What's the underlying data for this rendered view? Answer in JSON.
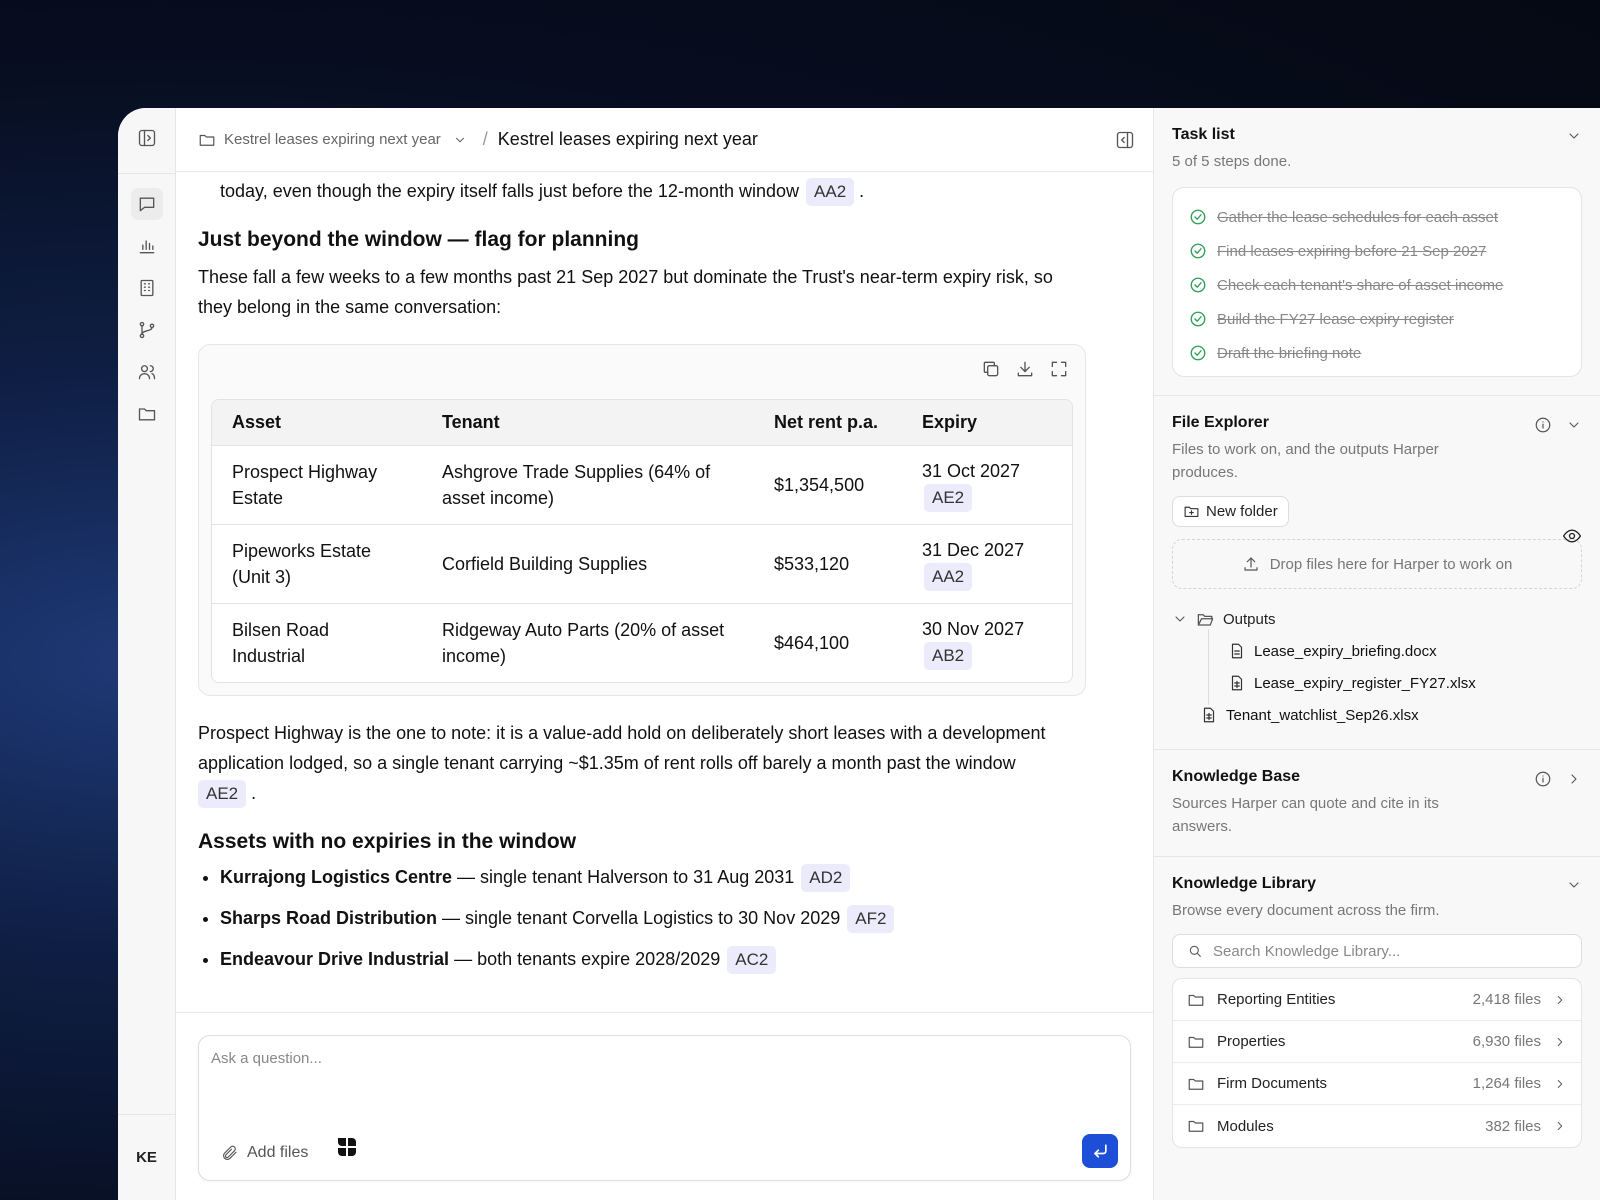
{
  "breadcrumb": {
    "folder": "Kestrel leases expiring next year",
    "title": "Kestrel leases expiring next year"
  },
  "rail": {
    "avatar": "KE"
  },
  "chat": {
    "prev_line": "today, even though the expiry itself falls just before the 12-month window",
    "prev_cite": "AA2",
    "section1_heading": "Just beyond the window — flag for planning",
    "section1_body": "These fall a few weeks to a few months past 21 Sep 2027 but dominate the Trust's near-term expiry risk, so they belong in the same conversation:",
    "table": {
      "headers": [
        "Asset",
        "Tenant",
        "Net rent p.a.",
        "Expiry"
      ],
      "rows": [
        {
          "asset": "Prospect Highway Estate",
          "tenant": "Ashgrove Trade Supplies (64% of asset income)",
          "rent": "$1,354,500",
          "expiry": "31 Oct 2027",
          "cite": "AE2"
        },
        {
          "asset": "Pipeworks Estate (Unit 3)",
          "tenant": "Corfield Building Supplies",
          "rent": "$533,120",
          "expiry": "31 Dec 2027",
          "cite": "AA2"
        },
        {
          "asset": "Bilsen Road Industrial",
          "tenant": "Ridgeway Auto Parts (20% of asset income)",
          "rent": "$464,100",
          "expiry": "30 Nov 2027",
          "cite": "AB2"
        }
      ]
    },
    "note_body": "Prospect Highway is the one to note: it is a value-add hold on deliberately short leases with a development application lodged, so a single tenant carrying ~$1.35m of rent rolls off barely a month past the window",
    "note_cite": "AE2",
    "section2_heading": "Assets with no expiries in the window",
    "bullets": [
      {
        "bold": "Kurrajong Logistics Centre",
        "text": " — single tenant Halverson to 31 Aug 2031",
        "cite": "AD2"
      },
      {
        "bold": "Sharps Road Distribution",
        "text": " — single tenant Corvella Logistics to 30 Nov 2029",
        "cite": "AF2"
      },
      {
        "bold": "Endeavour Drive Industrial",
        "text": " — both tenants expire 2028/2029",
        "cite": "AC2"
      }
    ]
  },
  "composer": {
    "placeholder": "Ask a question...",
    "add_files": "Add files"
  },
  "task_list": {
    "title": "Task list",
    "subtitle": "5 of 5 steps done.",
    "tasks": [
      "Gather the lease schedules for each asset",
      "Find leases expiring before 21 Sep 2027",
      "Check each tenant's share of asset income",
      "Build the FY27 lease expiry register",
      "Draft the briefing note"
    ]
  },
  "file_explorer": {
    "title": "File Explorer",
    "subtitle": "Files to work on, and the outputs Harper produces.",
    "new_folder": "New folder",
    "drop_text": "Drop files here for Harper to work on",
    "outputs_folder": "Outputs",
    "output_files": [
      "Lease_expiry_briefing.docx",
      "Lease_expiry_register_FY27.xlsx"
    ],
    "root_files": [
      "Tenant_watchlist_Sep26.xlsx"
    ]
  },
  "knowledge_base": {
    "title": "Knowledge Base",
    "subtitle": "Sources Harper can quote and cite in its answers."
  },
  "knowledge_library": {
    "title": "Knowledge Library",
    "subtitle": "Browse every document across the firm.",
    "search_placeholder": "Search Knowledge Library...",
    "folders": [
      {
        "name": "Reporting Entities",
        "count": "2,418 files"
      },
      {
        "name": "Properties",
        "count": "6,930 files"
      },
      {
        "name": "Firm Documents",
        "count": "1,264 files"
      },
      {
        "name": "Modules",
        "count": "382 files"
      }
    ]
  },
  "colors": {
    "accent": "#1d4ed8",
    "cite_bg": "#ecebfb",
    "check": "#2f9e5a"
  }
}
